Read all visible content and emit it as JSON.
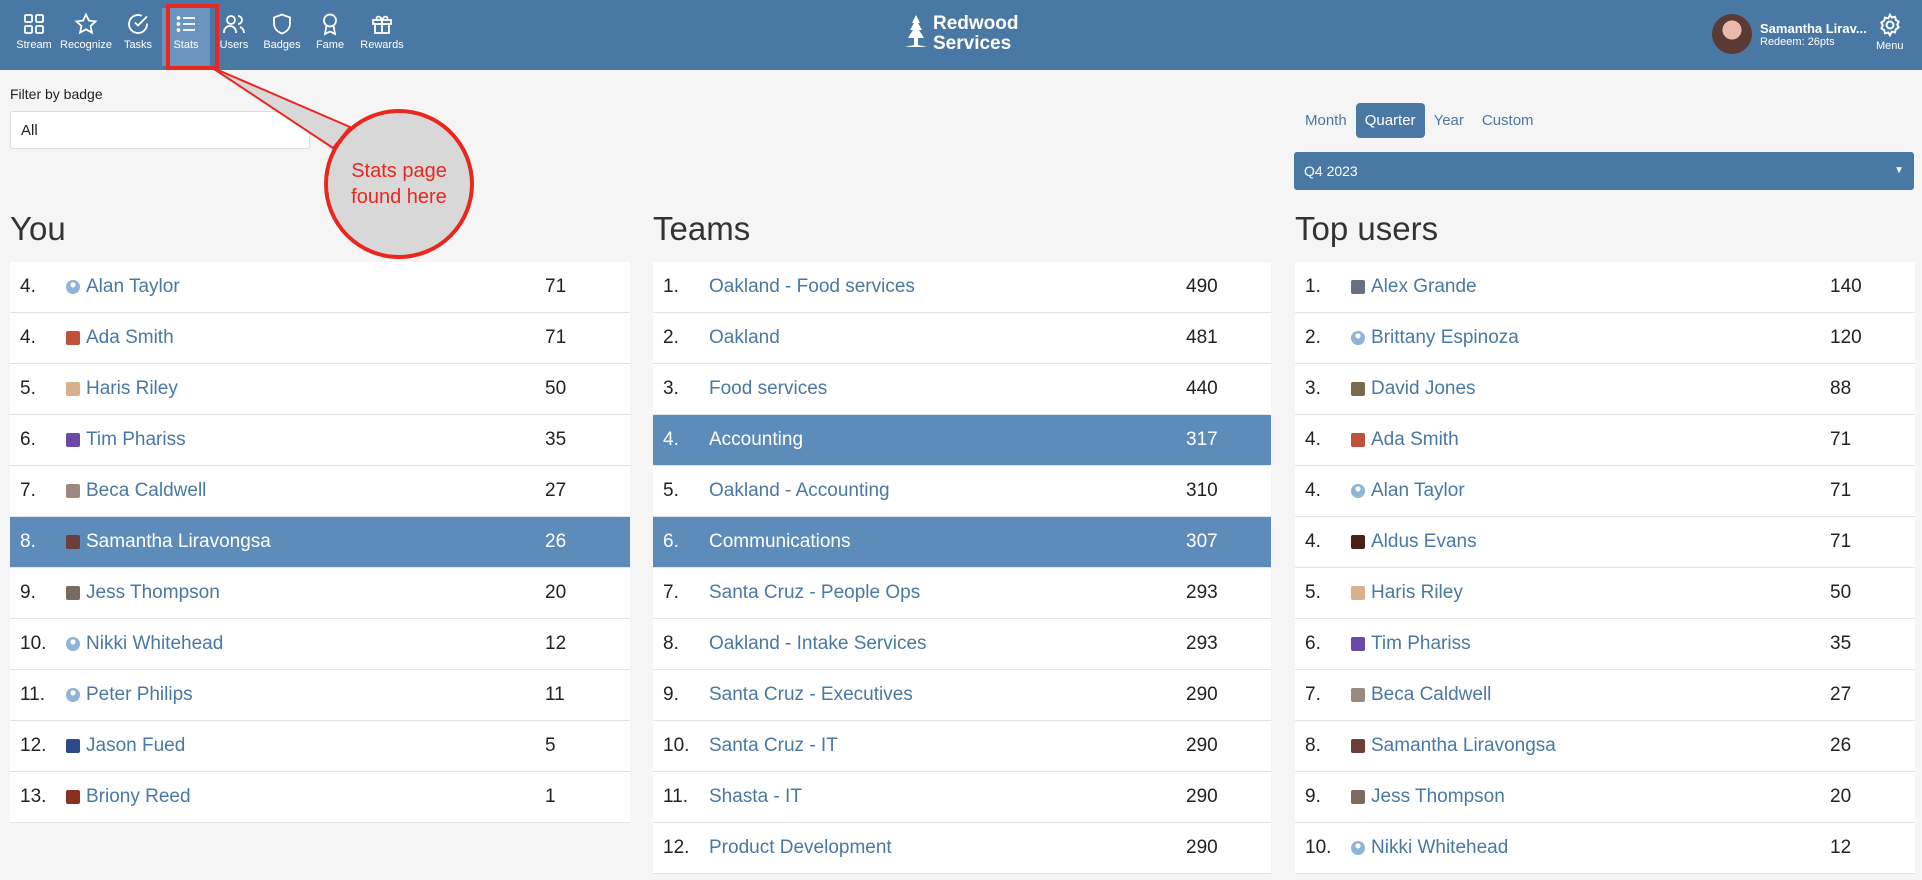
{
  "nav": {
    "items": [
      {
        "label": "Stream",
        "icon": "grid-icon"
      },
      {
        "label": "Recognize",
        "icon": "star-icon"
      },
      {
        "label": "Tasks",
        "icon": "check-circle-icon"
      },
      {
        "label": "Stats",
        "icon": "list-icon"
      },
      {
        "label": "Users",
        "icon": "users-icon"
      },
      {
        "label": "Badges",
        "icon": "shield-icon"
      },
      {
        "label": "Fame",
        "icon": "award-icon"
      },
      {
        "label": "Rewards",
        "icon": "gift-icon"
      }
    ],
    "active": "Stats"
  },
  "brand": {
    "line1": "Redwood",
    "line2": "Services"
  },
  "user": {
    "name": "Samantha Lirav...",
    "points": "Redeem: 26pts"
  },
  "menu": {
    "label": "Menu"
  },
  "filter": {
    "label": "Filter by badge",
    "value": "All"
  },
  "annotation": {
    "line1": "Stats page",
    "line2": "found here"
  },
  "period": {
    "tabs": [
      "Month",
      "Quarter",
      "Year",
      "Custom"
    ],
    "active": "Quarter",
    "selected": "Q4 2023"
  },
  "you": {
    "title": "You",
    "rows": [
      {
        "rank": "4.",
        "name": "Alan Taylor",
        "value": "71",
        "avatar": "default"
      },
      {
        "rank": "4.",
        "name": "Ada Smith",
        "value": "71",
        "avatar": "#c0503a"
      },
      {
        "rank": "5.",
        "name": "Haris Riley",
        "value": "50",
        "avatar": "#d8b08c"
      },
      {
        "rank": "6.",
        "name": "Tim Phariss",
        "value": "35",
        "avatar": "#6a4aa8"
      },
      {
        "rank": "7.",
        "name": "Beca Caldwell",
        "value": "27",
        "avatar": "#9a8a80"
      },
      {
        "rank": "8.",
        "name": "Samantha Liravongsa",
        "value": "26",
        "avatar": "#6a4038",
        "highlight": true
      },
      {
        "rank": "9.",
        "name": "Jess Thompson",
        "value": "20",
        "avatar": "#7a6a60"
      },
      {
        "rank": "10.",
        "name": "Nikki Whitehead",
        "value": "12",
        "avatar": "default"
      },
      {
        "rank": "11.",
        "name": "Peter Philips",
        "value": "11",
        "avatar": "default"
      },
      {
        "rank": "12.",
        "name": "Jason Fued",
        "value": "5",
        "avatar": "#2a4a8a"
      },
      {
        "rank": "13.",
        "name": "Briony Reed",
        "value": "1",
        "avatar": "#8a3020"
      }
    ]
  },
  "teams": {
    "title": "Teams",
    "rows": [
      {
        "rank": "1.",
        "name": "Oakland - Food services",
        "value": "490"
      },
      {
        "rank": "2.",
        "name": "Oakland",
        "value": "481"
      },
      {
        "rank": "3.",
        "name": "Food services",
        "value": "440"
      },
      {
        "rank": "4.",
        "name": "Accounting",
        "value": "317",
        "highlight": true
      },
      {
        "rank": "5.",
        "name": "Oakland - Accounting",
        "value": "310"
      },
      {
        "rank": "6.",
        "name": "Communications",
        "value": "307",
        "highlight": true
      },
      {
        "rank": "7.",
        "name": "Santa Cruz - People Ops",
        "value": "293"
      },
      {
        "rank": "8.",
        "name": "Oakland - Intake Services",
        "value": "293"
      },
      {
        "rank": "9.",
        "name": "Santa Cruz - Executives",
        "value": "290"
      },
      {
        "rank": "10.",
        "name": "Santa Cruz - IT",
        "value": "290"
      },
      {
        "rank": "11.",
        "name": "Shasta - IT",
        "value": "290"
      },
      {
        "rank": "12.",
        "name": "Product Development",
        "value": "290"
      }
    ]
  },
  "top_users": {
    "title": "Top users",
    "rows": [
      {
        "rank": "1.",
        "name": "Alex Grande",
        "value": "140",
        "avatar": "#6a7080"
      },
      {
        "rank": "2.",
        "name": "Brittany Espinoza",
        "value": "120",
        "avatar": "default"
      },
      {
        "rank": "3.",
        "name": "David Jones",
        "value": "88",
        "avatar": "#7a6a50"
      },
      {
        "rank": "4.",
        "name": "Ada Smith",
        "value": "71",
        "avatar": "#c0503a"
      },
      {
        "rank": "4.",
        "name": "Alan Taylor",
        "value": "71",
        "avatar": "default"
      },
      {
        "rank": "4.",
        "name": "Aldus Evans",
        "value": "71",
        "avatar": "#4a2018"
      },
      {
        "rank": "5.",
        "name": "Haris Riley",
        "value": "50",
        "avatar": "#d8b08c"
      },
      {
        "rank": "6.",
        "name": "Tim Phariss",
        "value": "35",
        "avatar": "#6a4aa8"
      },
      {
        "rank": "7.",
        "name": "Beca Caldwell",
        "value": "27",
        "avatar": "#9a8a80"
      },
      {
        "rank": "8.",
        "name": "Samantha Liravongsa",
        "value": "26",
        "avatar": "#6a4038"
      },
      {
        "rank": "9.",
        "name": "Jess Thompson",
        "value": "20",
        "avatar": "#7a6a60"
      },
      {
        "rank": "10.",
        "name": "Nikki Whitehead",
        "value": "12",
        "avatar": "default"
      }
    ]
  },
  "colors": {
    "brand": "#4a78a4",
    "highlight_row": "#5e8cba",
    "annotation": "#e8281e"
  }
}
